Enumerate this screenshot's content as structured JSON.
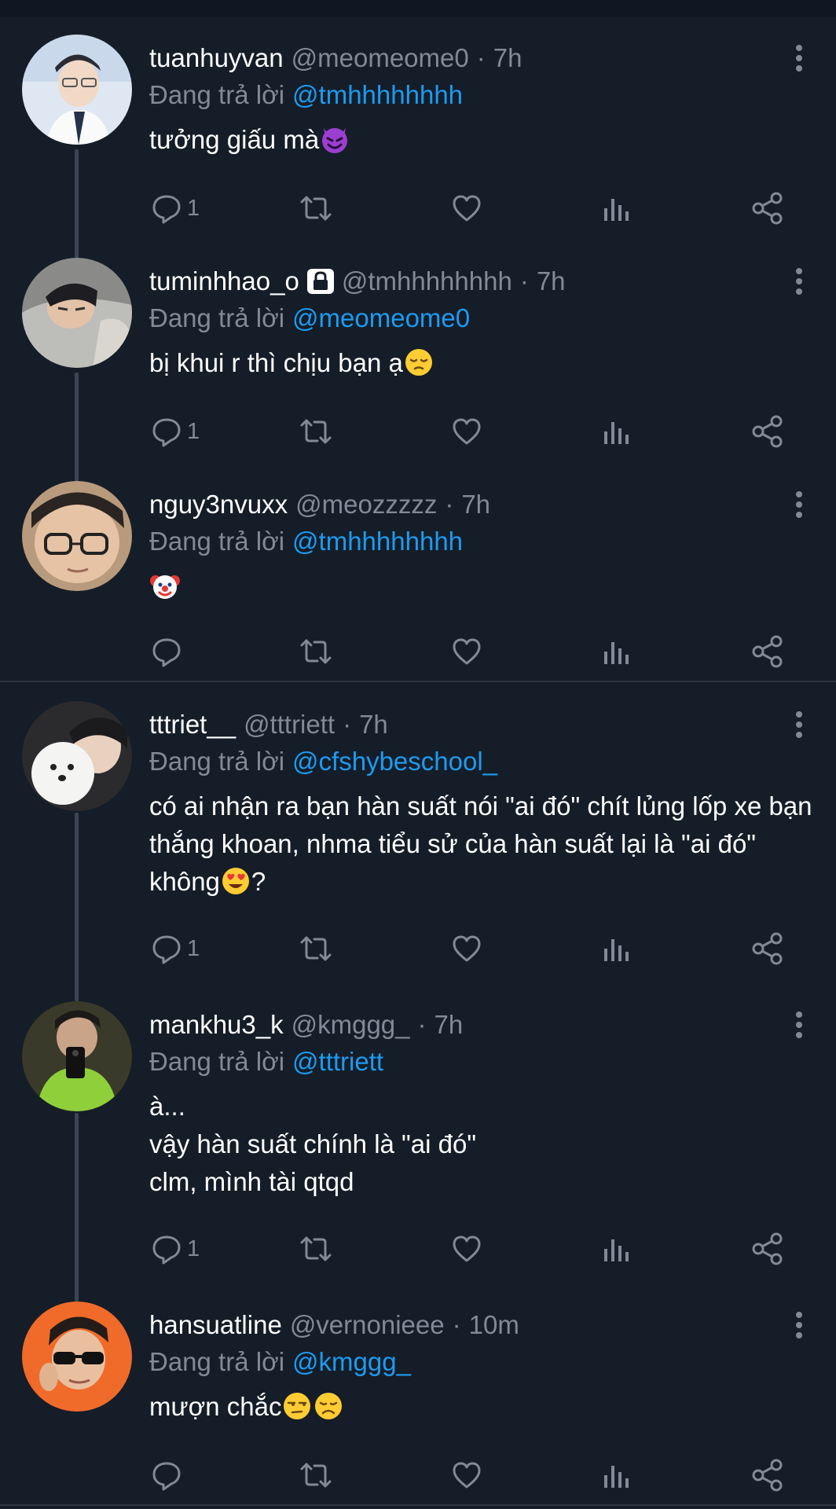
{
  "colors": {
    "background": "#151d28",
    "muted": "#808b97",
    "mention": "#1d9bf0",
    "thread_line": "#3a4654"
  },
  "reply_prefix": "Đang trả lời",
  "tweets": [
    {
      "display_name": "tuanhuyvan",
      "handle": "@meomeome0",
      "time": "7h",
      "replying_to": "@tmhhhhhhhh",
      "text_lines": [
        "tưởng giấu mà"
      ],
      "emoji": [
        "smiling-devil"
      ],
      "reply_count": "1",
      "avatar": "avatar-boy-white-shirt"
    },
    {
      "display_name": "tuminhhao_o",
      "handle": "@tmhhhhhhhh",
      "time": "7h",
      "replying_to": "@meomeome0",
      "text_lines": [
        "bị khui r thì chịu bạn ạ"
      ],
      "emoji": [
        "pensive-face"
      ],
      "reply_count": "1",
      "avatar": "avatar-sleeping-boy",
      "locked_icon": "lock-icon"
    },
    {
      "display_name": "nguy3nvuxx",
      "handle": "@meozzzzz",
      "time": "7h",
      "replying_to": "@tmhhhhhhhh",
      "text_lines": [
        ""
      ],
      "emoji": [
        "clown-face"
      ],
      "reply_count": "",
      "avatar": "avatar-glasses-face"
    },
    {
      "display_name": "tttriet__",
      "handle": "@tttriett",
      "time": "7h",
      "replying_to": "@cfshybeschool_",
      "text_lines": [
        "có ai nhận ra bạn hàn suất nói \"ai đó\" chít lủng lốp xe bạn",
        "thắng khoan, nhma tiểu sử của hàn suất lại là \"ai đó\"",
        "không"
      ],
      "trailing_after_emoji": "?",
      "emoji": [
        "heart-eyes"
      ],
      "reply_count": "1",
      "avatar": "avatar-boy-with-dog"
    },
    {
      "display_name": "mankhu3_k",
      "handle": "@kmggg_",
      "time": "7h",
      "replying_to": "@tttriett",
      "text_lines": [
        "à...",
        "vậy hàn suất chính là \"ai đó\"",
        "clm, mình tài qtqd"
      ],
      "emoji": [],
      "reply_count": "1",
      "avatar": "avatar-mirror-selfie"
    },
    {
      "display_name": "hansuatline",
      "handle": "@vernonieee",
      "time": "10m",
      "replying_to": "@kmggg_",
      "text_lines": [
        "mượn chắc"
      ],
      "emoji": [
        "unamused-face",
        "disappointed-face"
      ],
      "reply_count": "",
      "avatar": "avatar-sunglasses-boy"
    }
  ]
}
